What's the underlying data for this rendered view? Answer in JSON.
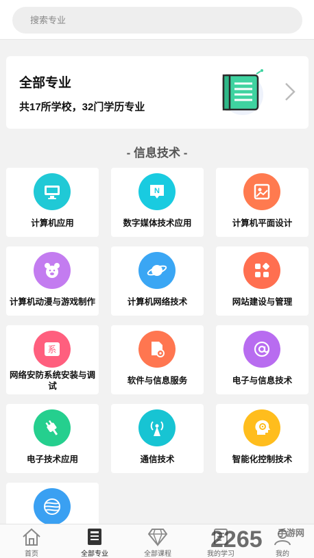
{
  "search": {
    "placeholder": "搜索专业"
  },
  "banner": {
    "title": "全部专业",
    "subtitle": "共17所学校，32门学历专业"
  },
  "section": {
    "title": "- 信息技术 -"
  },
  "majors": [
    {
      "label": "计算机应用",
      "icon": "monitor-icon",
      "color": "#20c9d6"
    },
    {
      "label": "数字媒体技术应用",
      "icon": "chat-n-icon",
      "color": "#19cbe0"
    },
    {
      "label": "计算机平面设计",
      "icon": "picture-icon",
      "color": "#ff7a4f"
    },
    {
      "label": "计算机动漫与游戏制作",
      "icon": "bear-icon",
      "color": "#c37cf0"
    },
    {
      "label": "计算机网络技术",
      "icon": "planet-icon",
      "color": "#3aa6f4"
    },
    {
      "label": "网站建设与管理",
      "icon": "blocks-icon",
      "color": "#ff6f50"
    },
    {
      "label": "网络安防系统安装与调试",
      "icon": "system-icon",
      "color": "#ff5f7e"
    },
    {
      "label": "软件与信息服务",
      "icon": "file-gear-icon",
      "color": "#ff7650"
    },
    {
      "label": "电子与信息技术",
      "icon": "at-icon",
      "color": "#b86cf0"
    },
    {
      "label": "电子技术应用",
      "icon": "plug-icon",
      "color": "#25cf8e"
    },
    {
      "label": "通信技术",
      "icon": "signal-tower-icon",
      "color": "#17c4d3"
    },
    {
      "label": "智能化控制技术",
      "icon": "head-gear-icon",
      "color": "#ffbd1d"
    },
    {
      "label": "",
      "icon": "globe-icon",
      "color": "#3aa0f2"
    }
  ],
  "majors_glyph": {
    "system": "系",
    "chat": "N"
  },
  "tabs": [
    {
      "label": "首页",
      "icon": "home-icon",
      "active": false
    },
    {
      "label": "全部专业",
      "icon": "book-icon",
      "active": true
    },
    {
      "label": "全部课程",
      "icon": "diamond-icon",
      "active": false
    },
    {
      "label": "我的学习",
      "icon": "study-icon",
      "active": false
    },
    {
      "label": "我的",
      "icon": "user-icon",
      "active": false
    }
  ],
  "watermark": {
    "brand": "2265",
    "site": "手游网"
  }
}
